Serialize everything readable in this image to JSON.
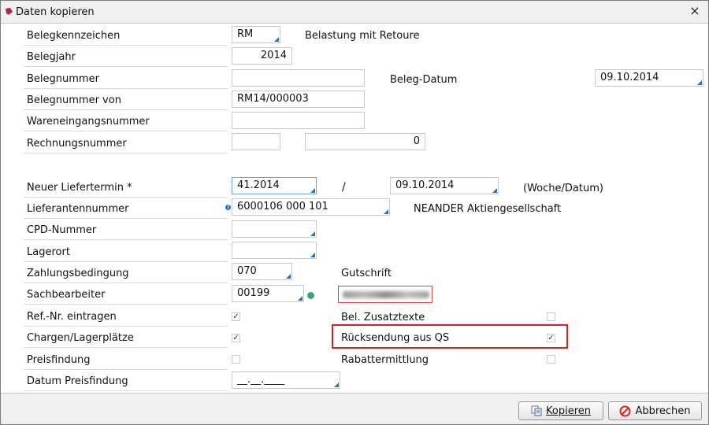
{
  "window": {
    "title": "Daten kopieren",
    "close_symbol": "×"
  },
  "form": {
    "belegkennzeichen": {
      "label": "Belegkennzeichen",
      "value": "RM",
      "desc": "Belastung mit Retoure"
    },
    "belegjahr": {
      "label": "Belegjahr",
      "value": "2014"
    },
    "belegnummer": {
      "label": "Belegnummer",
      "value": ""
    },
    "beleg_datum": {
      "label": "Beleg-Datum",
      "value": "09.10.2014"
    },
    "belegnummer_von": {
      "label": "Belegnummer von",
      "value": "RM14/000003"
    },
    "wareneingangsnummer": {
      "label": "Wareneingangsnummer",
      "value": ""
    },
    "rechnungsnummer": {
      "label": "Rechnungsnummer",
      "value1": "",
      "value2": "0"
    },
    "neuer_liefertermin": {
      "label": "Neuer Liefertermin *",
      "week": "41.2014",
      "sep": "/",
      "date": "09.10.2014",
      "hint": "(Woche/Datum)"
    },
    "lieferantennummer": {
      "label": "Lieferantennummer",
      "info": "i",
      "value": "6000106 000 101",
      "desc": "NEANDER Aktiengesellschaft"
    },
    "cpd_nummer": {
      "label": "CPD-Nummer",
      "value": ""
    },
    "lagerort": {
      "label": "Lagerort",
      "value": ""
    },
    "zahlungsbedingung": {
      "label": "Zahlungsbedingung",
      "value": "070",
      "desc": "Gutschrift"
    },
    "sachbearbeiter": {
      "label": "Sachbearbeiter",
      "value": "00199"
    },
    "ref_nr": {
      "label": "Ref.-Nr. eintragen",
      "checked": true
    },
    "bel_zusatztexte": {
      "label": "Bel. Zusatztexte",
      "checked": false
    },
    "chargen": {
      "label": "Chargen/Lagerplätze",
      "checked": true
    },
    "ruecksendung": {
      "label": "Rücksendung aus QS",
      "checked": true
    },
    "preisfindung": {
      "label": "Preisfindung",
      "checked": false
    },
    "rabattermittlung": {
      "label": "Rabattermittlung",
      "checked": false
    },
    "datum_preisfindung": {
      "label": "Datum Preisfindung",
      "value": "__.__.____"
    }
  },
  "buttons": {
    "kopieren": "Kopieren",
    "abbrechen": "Abbrechen"
  },
  "colors": {
    "accent": "#1e6fcf",
    "highlight": "#e01e1e",
    "status_green": "#3aa57a"
  }
}
